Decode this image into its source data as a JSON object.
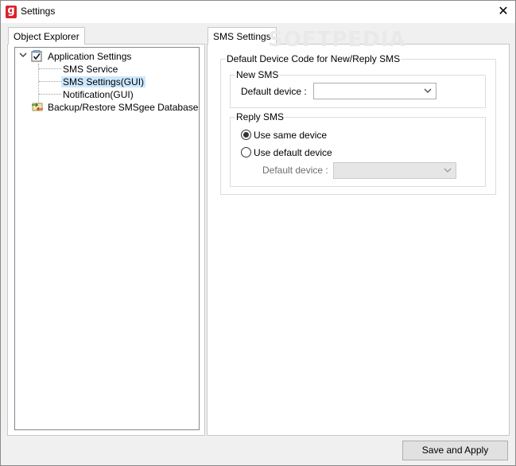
{
  "window": {
    "title": "Settings",
    "app_icon_letter": "g",
    "close_glyph": "✕"
  },
  "left": {
    "tab_label": "Object Explorer",
    "tree": [
      {
        "label": "Application Settings",
        "icon": "checkbox-settings-icon"
      },
      {
        "label": "SMS Service"
      },
      {
        "label": "SMS Settings(GUI)",
        "selected": true
      },
      {
        "label": "Notification(GUI)"
      },
      {
        "label": "Backup/Restore SMSgee Database",
        "icon": "backup-restore-icon"
      }
    ]
  },
  "right": {
    "tab_label": "SMS Settings",
    "watermark": "SOFTPEDIA",
    "default_group_label": "Default Device Code for New/Reply SMS",
    "new_sms": {
      "group_label": "New SMS",
      "device_label": "Default device :",
      "device_value": ""
    },
    "reply_sms": {
      "group_label": "Reply SMS",
      "option_same": "Use same device",
      "option_default": "Use default device",
      "selected": "same",
      "device_label": "Default device :",
      "device_value": ""
    }
  },
  "footer": {
    "save_label": "Save and Apply"
  },
  "colors": {
    "accent_selection": "#cce8ff",
    "brand": "#d9232a"
  }
}
